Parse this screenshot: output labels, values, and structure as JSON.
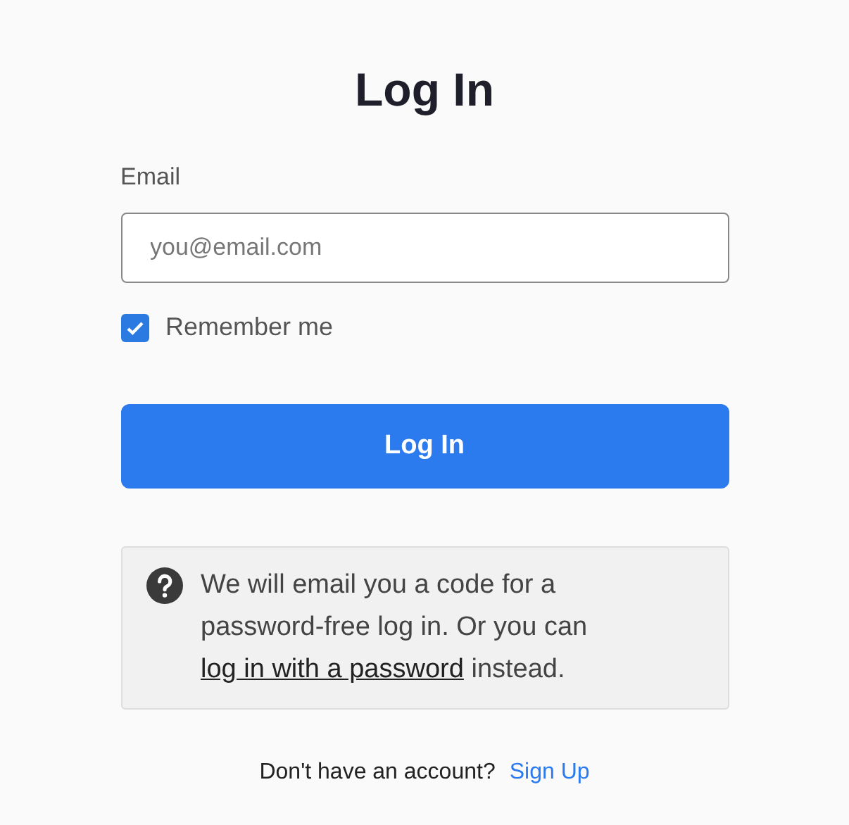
{
  "title": "Log In",
  "email_field": {
    "label": "Email",
    "placeholder": "you@email.com"
  },
  "remember": {
    "label": "Remember me",
    "checked": true
  },
  "submit_button": "Log In",
  "info": {
    "text_before": "We will email you a code for a password-free log in. Or you can",
    "link": "log in with a password",
    "text_after": "instead."
  },
  "footer": {
    "text": "Don't have an account?",
    "link": "Sign Up"
  }
}
